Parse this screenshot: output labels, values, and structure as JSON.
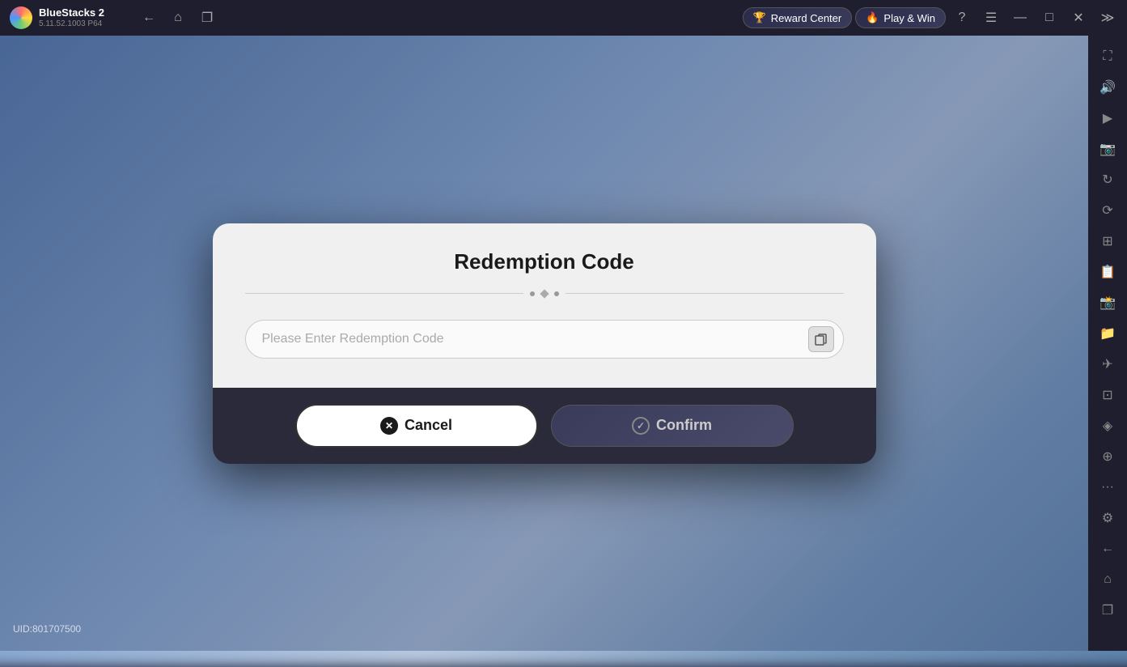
{
  "app": {
    "name": "BlueStacks 2",
    "version": "5.11.52.1003  P64",
    "logo_alt": "BlueStacks logo"
  },
  "topbar": {
    "back_label": "←",
    "home_label": "⌂",
    "clone_label": "❐",
    "reward_label": "Reward Center",
    "reward_emoji": "🏆",
    "playnwin_label": "Play & Win",
    "playnwin_emoji": "🔥",
    "help_label": "?",
    "menu_label": "☰",
    "minimize_label": "—",
    "maximize_label": "□",
    "close_label": "✕",
    "more_label": "≫"
  },
  "sidebar": {
    "items": [
      {
        "icon": "⛶",
        "name": "fullscreen"
      },
      {
        "icon": "🔊",
        "name": "volume"
      },
      {
        "icon": "▶",
        "name": "play"
      },
      {
        "icon": "📷",
        "name": "screenshot"
      },
      {
        "icon": "↻",
        "name": "rotate"
      },
      {
        "icon": "⟳",
        "name": "refresh"
      },
      {
        "icon": "⊞",
        "name": "multi"
      },
      {
        "icon": "📋",
        "name": "macro"
      },
      {
        "icon": "📸",
        "name": "capture"
      },
      {
        "icon": "📁",
        "name": "folder"
      },
      {
        "icon": "✈",
        "name": "airplane"
      },
      {
        "icon": "⊡",
        "name": "resize"
      },
      {
        "icon": "◈",
        "name": "paint"
      },
      {
        "icon": "⊕",
        "name": "location"
      },
      {
        "icon": "•••",
        "name": "more"
      },
      {
        "icon": "⚙",
        "name": "settings"
      },
      {
        "icon": "←",
        "name": "back"
      },
      {
        "icon": "⌂",
        "name": "home"
      },
      {
        "icon": "❐",
        "name": "recent"
      }
    ]
  },
  "modal": {
    "title": "Redemption Code",
    "input_placeholder": "Please Enter Redemption Code",
    "cancel_label": "Cancel",
    "confirm_label": "Confirm"
  },
  "uid": {
    "label": "UID:801707500"
  }
}
